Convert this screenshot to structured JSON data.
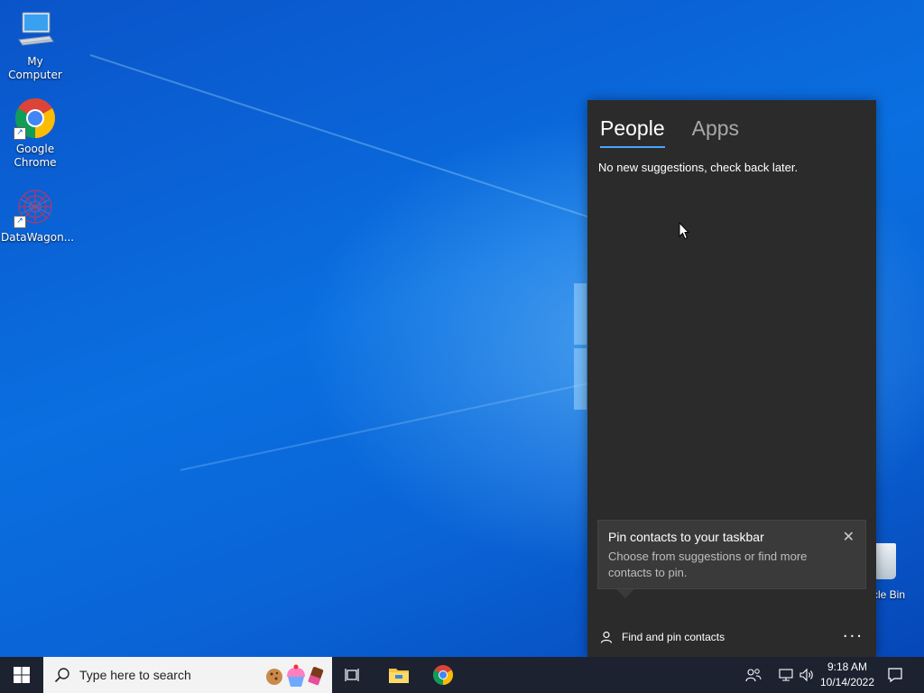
{
  "desktop": {
    "icons": [
      {
        "label": "My Computer",
        "icon": "computer-icon",
        "shortcut": false
      },
      {
        "label": "Google Chrome",
        "icon": "chrome-icon",
        "shortcut": true
      },
      {
        "label": "DataWagon...",
        "icon": "datawagon-icon",
        "shortcut": true
      }
    ],
    "recycle_bin_label": "cle Bin"
  },
  "people_panel": {
    "tabs": [
      "People",
      "Apps"
    ],
    "active_tab": "People",
    "suggestion_text": "No new suggestions, check back later.",
    "tooltip": {
      "title": "Pin contacts to your taskbar",
      "body": "Choose from suggestions or find more contacts to pin.",
      "close_glyph": "✕"
    },
    "find_pin_label": "Find and pin contacts",
    "more_glyph": "···"
  },
  "taskbar": {
    "search_placeholder": "Type here to search",
    "pinned": [
      "task-view-icon",
      "file-explorer-icon",
      "chrome-icon"
    ],
    "tray_icons": [
      "people-icon",
      "network-icon",
      "volume-icon"
    ],
    "time": "9:18 AM",
    "date": "10/14/2022",
    "notification_icon": "action-center-icon"
  },
  "colors": {
    "panel_bg": "#2b2b2b",
    "accent": "#4da3ff",
    "taskbar_bg": "#1c2230"
  }
}
